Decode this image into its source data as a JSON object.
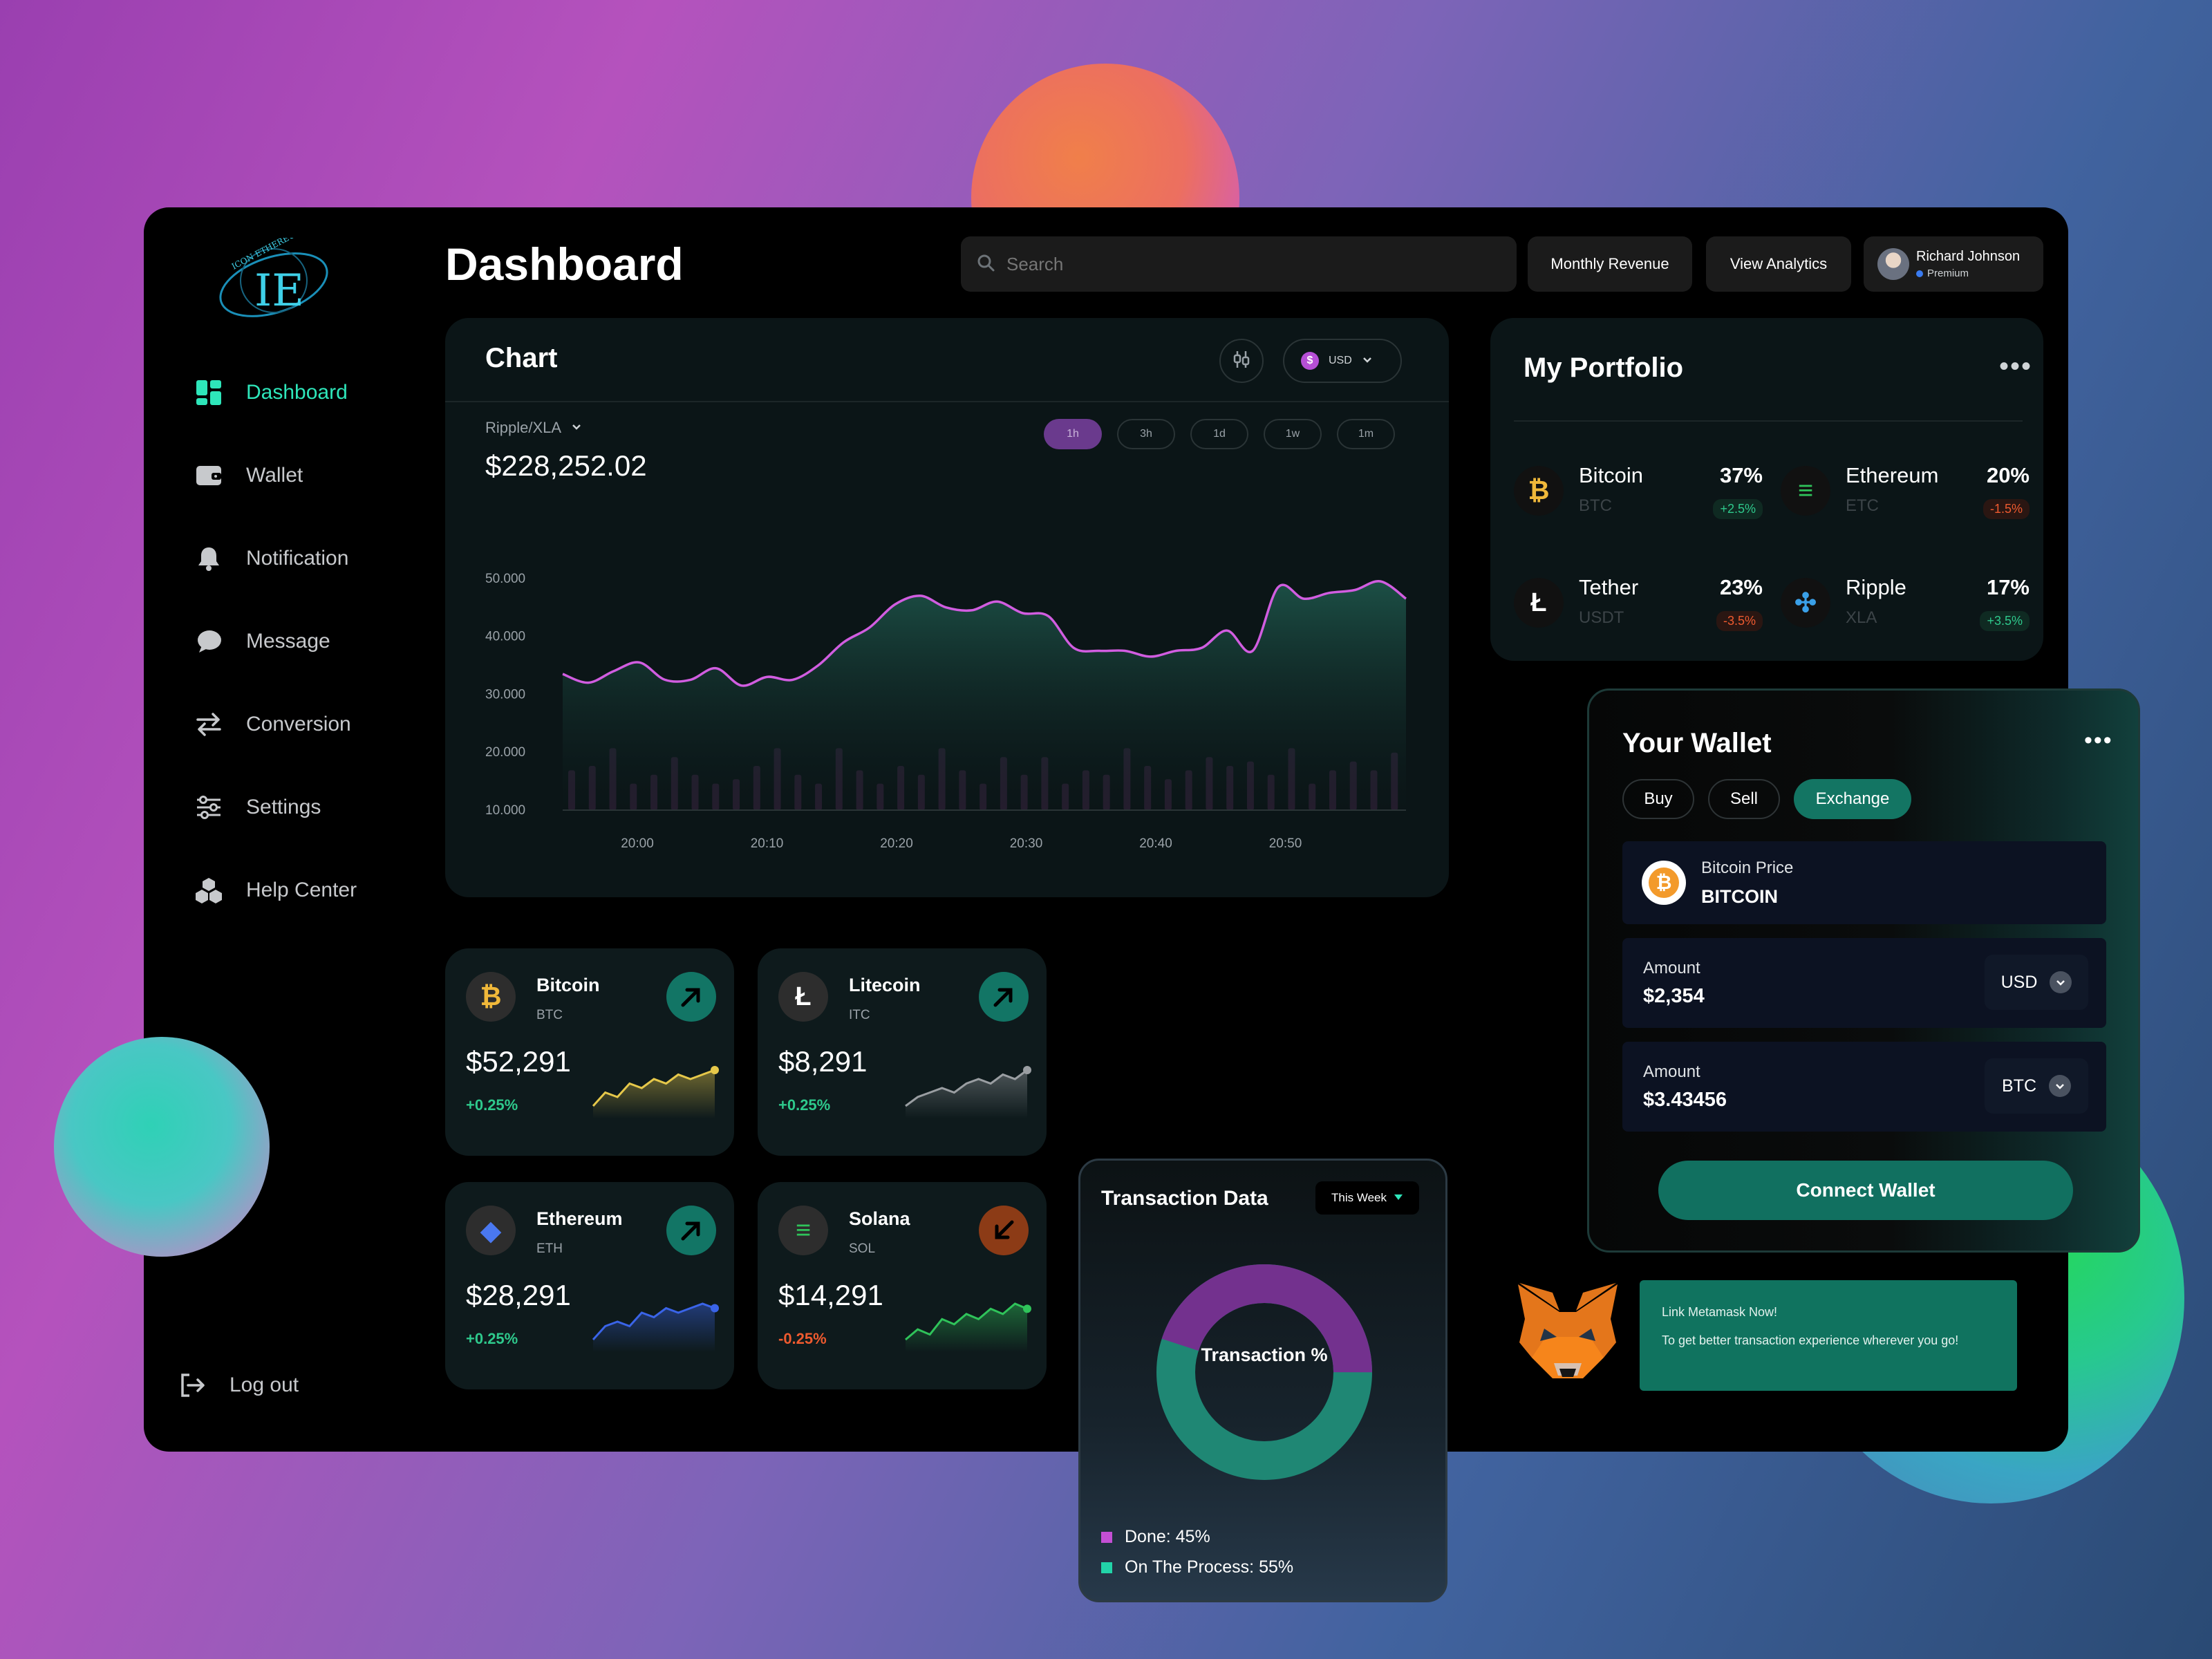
{
  "colors": {
    "accent": "#2ee6ba",
    "panel": "#000000",
    "card": "#0d1414",
    "positive": "#2ec98c",
    "negative": "#ee5a2f",
    "chart_line": "#d15de0"
  },
  "sidebar": {
    "items": [
      {
        "label": "Dashboard",
        "icon": "dashboard-grid-icon"
      },
      {
        "label": "Wallet",
        "icon": "wallet-icon"
      },
      {
        "label": "Notification",
        "icon": "bell-icon"
      },
      {
        "label": "Message",
        "icon": "chat-icon"
      },
      {
        "label": "Conversion",
        "icon": "swap-arrows-icon"
      },
      {
        "label": "Settings",
        "icon": "sliders-icon"
      },
      {
        "label": "Help Center",
        "icon": "cubes-icon"
      }
    ],
    "logout": "Log out"
  },
  "header": {
    "title": "Dashboard",
    "search_placeholder": "Search",
    "monthly_revenue": "Monthly Revenue",
    "view_analytics": "View Analytics",
    "user": {
      "name": "Richard Johnson",
      "tier": "Premium"
    }
  },
  "chart": {
    "title": "Chart",
    "currency": "USD",
    "pair": "Ripple/XLA",
    "price": "$228,252.02",
    "ranges": [
      "1h",
      "3h",
      "1d",
      "1w",
      "1m"
    ],
    "active_range": "1h"
  },
  "chart_data": {
    "type": "area",
    "x_ticks": [
      "20:00",
      "20:10",
      "20:20",
      "20:30",
      "20:40",
      "20:50"
    ],
    "y_ticks": [
      "50.000",
      "40.000",
      "30.000",
      "20.000",
      "10.000"
    ],
    "ylim": [
      10000,
      52000
    ],
    "series": [
      {
        "values": [
          33500,
          32000,
          34000,
          35500,
          32500,
          32500,
          34500,
          31500,
          33000,
          32500,
          35000,
          39000,
          41500,
          45500,
          47000,
          45000,
          44500,
          46000,
          44000,
          43500,
          38000,
          37500,
          37500,
          36500,
          37500,
          38000,
          41000,
          37500,
          48500,
          46500,
          47500,
          48000,
          49500,
          46500
        ]
      }
    ],
    "volume": [
      9,
      10,
      14,
      6,
      8,
      12,
      8,
      6,
      7,
      10,
      14,
      8,
      6,
      14,
      9,
      6,
      10,
      8,
      14,
      9,
      6,
      12,
      8,
      12,
      6,
      9,
      8,
      14,
      10,
      7,
      9,
      12,
      10,
      11,
      8,
      14,
      6,
      9,
      11,
      9,
      13
    ]
  },
  "portfolio": {
    "title": "My Portfolio",
    "items": [
      {
        "name": "Bitcoin",
        "symbol": "BTC",
        "share": "37%",
        "change": "+2.5%",
        "up": true,
        "icon": "bitcoin-icon"
      },
      {
        "name": "Ethereum",
        "symbol": "ETC",
        "share": "20%",
        "change": "-1.5%",
        "up": false,
        "icon": "ethereum-bars-icon"
      },
      {
        "name": "Tether",
        "symbol": "USDT",
        "share": "23%",
        "change": "-3.5%",
        "up": false,
        "icon": "tether-icon"
      },
      {
        "name": "Ripple",
        "symbol": "XLA",
        "share": "17%",
        "change": "+3.5%",
        "up": true,
        "icon": "ripple-icon"
      }
    ]
  },
  "coins": [
    {
      "name": "Bitcoin",
      "symbol": "BTC",
      "price": "$52,291",
      "change": "+0.25%",
      "up": true,
      "color": "#e6c84a",
      "spark": [
        2,
        5,
        4,
        7,
        6,
        8,
        7,
        9,
        8,
        9,
        10
      ]
    },
    {
      "name": "Litecoin",
      "symbol": "ITC",
      "price": "$8,291",
      "change": "+0.25%",
      "up": true,
      "color": "#9a9ea2",
      "spark": [
        2,
        4,
        5,
        6,
        5,
        7,
        8,
        7,
        9,
        8,
        10
      ]
    },
    {
      "name": "Ethereum",
      "symbol": "ETH",
      "price": "$28,291",
      "change": "+0.25%",
      "up": true,
      "color": "#3a64e8",
      "spark": [
        2,
        5,
        6,
        5,
        8,
        7,
        9,
        8,
        9,
        10,
        9
      ]
    },
    {
      "name": "Solana",
      "symbol": "SOL",
      "price": "$14,291",
      "change": "-0.25%",
      "up": false,
      "color": "#2fc35a",
      "spark": [
        2,
        4,
        3,
        6,
        5,
        7,
        6,
        8,
        7,
        9,
        8
      ]
    }
  ],
  "transaction": {
    "title": "Transaction Data",
    "period": "This Week",
    "center_label": "Transaction %",
    "done_label": "Done: 45%",
    "process_label": "On The Process: 55%",
    "done": 45,
    "process": 55
  },
  "wallet": {
    "title": "Your Wallet",
    "tabs": [
      "Buy",
      "Sell",
      "Exchange"
    ],
    "active_tab": "Exchange",
    "price_label": "Bitcoin Price",
    "price_value": "BITCOIN",
    "amount1_label": "Amount",
    "amount1_value": "$2,354",
    "amount1_currency": "USD",
    "amount2_label": "Amount",
    "amount2_value": "$3.43456",
    "amount2_currency": "BTC",
    "connect": "Connect Wallet"
  },
  "metamask": {
    "title": "Link Metamask Now!",
    "text": "To get better transaction experience wherever you go!"
  }
}
